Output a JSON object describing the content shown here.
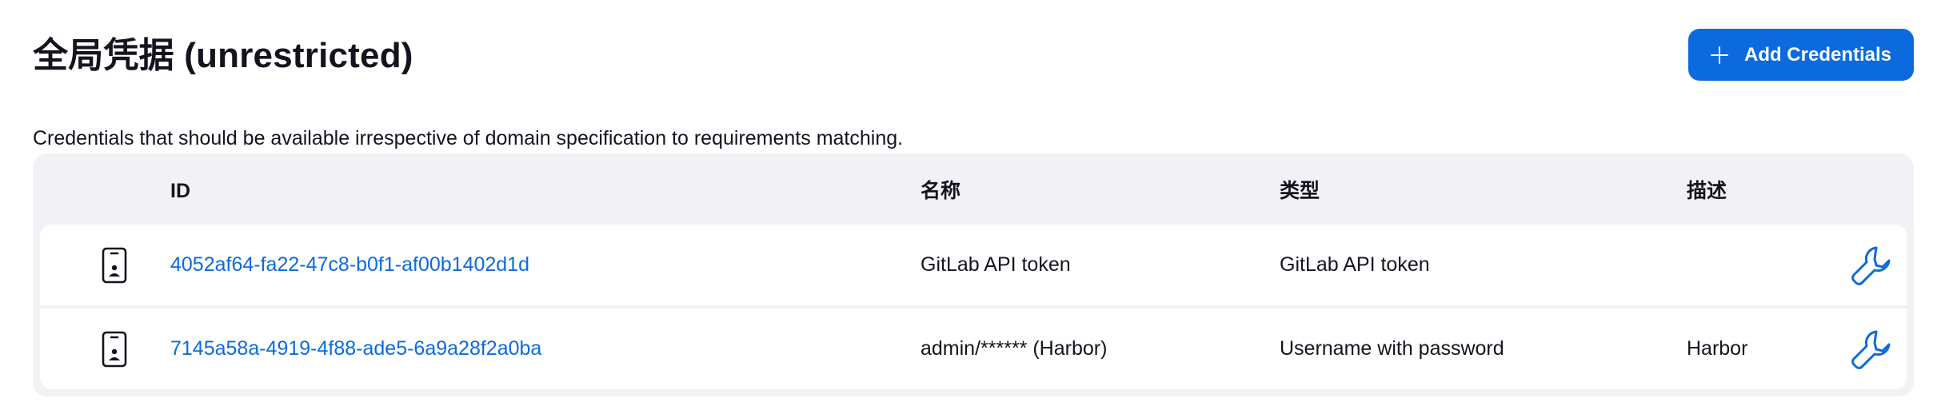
{
  "header": {
    "title": "全局凭据 (unrestricted)",
    "add_button_label": "Add Credentials",
    "description": "Credentials that should be available irrespective of domain specification to requirements matching."
  },
  "table": {
    "columns": {
      "id": "ID",
      "name": "名称",
      "type": "类型",
      "description": "描述"
    },
    "rows": [
      {
        "icon": "phone-icon",
        "id": "4052af64-fa22-47c8-b0f1-af00b1402d1d",
        "name": "GitLab API token",
        "type": "GitLab API token",
        "description": "",
        "action_icon": "wrench-icon"
      },
      {
        "icon": "phone-icon",
        "id": "7145a58a-4919-4f88-ade5-6a9a28f2a0ba",
        "name": "admin/****** (Harbor)",
        "type": "Username with password",
        "description": "Harbor",
        "action_icon": "wrench-icon"
      }
    ]
  },
  "colors": {
    "accent": "#0b6bde",
    "table_background": "#f2f2f6",
    "text": "#14141f"
  }
}
